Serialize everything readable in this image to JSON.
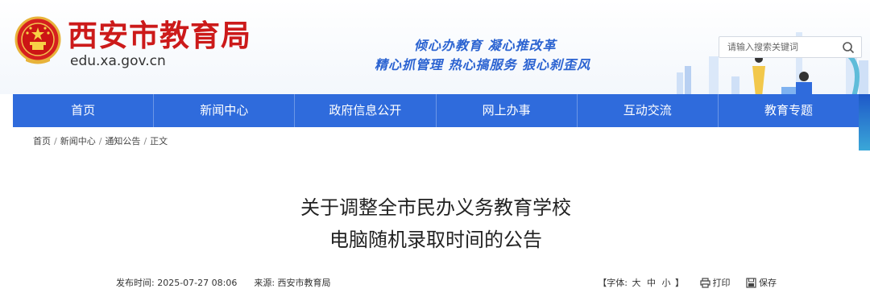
{
  "header": {
    "title": "西安市教育局",
    "domain": "edu.xa.gov.cn",
    "slogan_line1": "倾心办教育  凝心推改革",
    "slogan_line2": "精心抓管理  热心搞服务  狠心刹歪风",
    "emblem_icon": "national-emblem-icon",
    "search_placeholder": "请输入搜索关键词"
  },
  "nav": {
    "items": [
      "首页",
      "新闻中心",
      "政府信息公开",
      "网上办事",
      "互动交流",
      "教育专题"
    ]
  },
  "breadcrumb": {
    "items": [
      "首页",
      "新闻中心",
      "通知公告",
      "正文"
    ],
    "separator": "/"
  },
  "article": {
    "title_line1": "关于调整全市民办义务教育学校",
    "title_line2": "电脑随机录取时间的公告",
    "publish_label": "发布时间:",
    "publish_time": "2025-07-27 08:06",
    "source_label": "来源:",
    "source": "西安市教育局",
    "font_label_open": "【字体:",
    "font_large": "大",
    "font_medium": "中",
    "font_small": "小",
    "font_label_close": "】",
    "print_label": "打印",
    "save_label": "保存"
  },
  "colors": {
    "brand_red": "#cc1a1a",
    "nav_blue": "#2f6bdc",
    "slogan_blue": "#2b63d1"
  }
}
